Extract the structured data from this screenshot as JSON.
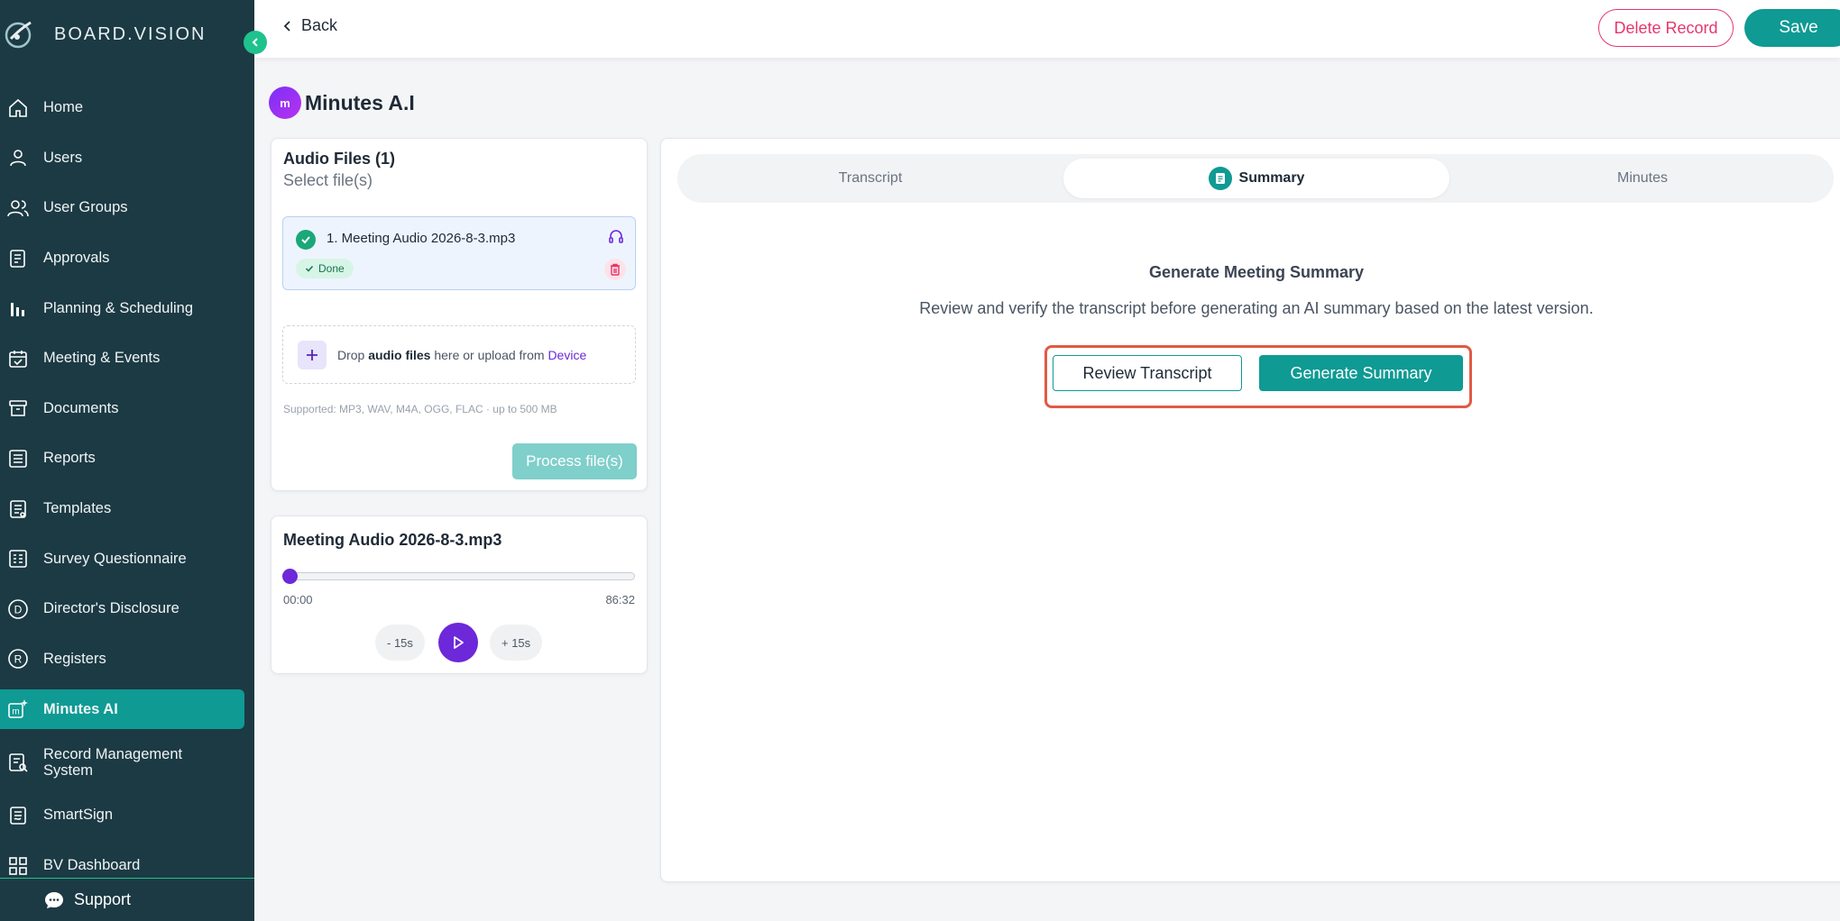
{
  "app": {
    "brand": "BOARD.VISION"
  },
  "sidebar": {
    "items": [
      {
        "label": "Home",
        "icon": "home-icon"
      },
      {
        "label": "Users",
        "icon": "user-icon"
      },
      {
        "label": "User Groups",
        "icon": "users-icon"
      },
      {
        "label": "Approvals",
        "icon": "document-check-icon"
      },
      {
        "label": "Planning & Scheduling",
        "icon": "bar-chart-icon"
      },
      {
        "label": "Meeting & Events",
        "icon": "calendar-icon"
      },
      {
        "label": "Documents",
        "icon": "archive-icon"
      },
      {
        "label": "Reports",
        "icon": "list-icon"
      },
      {
        "label": "Templates",
        "icon": "template-icon"
      },
      {
        "label": "Survey Questionnaire",
        "icon": "survey-icon"
      },
      {
        "label": "Director's Disclosure",
        "icon": "d-circle-icon"
      },
      {
        "label": "Registers",
        "icon": "r-circle-icon"
      },
      {
        "label": "Minutes AI",
        "icon": "minutes-ai-icon",
        "active": true
      },
      {
        "label": "Record Management System",
        "icon": "record-search-icon"
      },
      {
        "label": "SmartSign",
        "icon": "smartsign-icon"
      },
      {
        "label": "BV Dashboard",
        "icon": "grid-icon"
      }
    ],
    "support_label": "Support"
  },
  "topbar": {
    "back_label": "Back",
    "delete_label": "Delete Record",
    "save_label": "Save"
  },
  "page": {
    "title": "Minutes A.I",
    "badge": "m"
  },
  "files": {
    "title": "Audio Files (1)",
    "subtitle": "Select file(s)",
    "items": [
      {
        "name": "1. Meeting Audio 2026-8-3.mp3",
        "status": "Done"
      }
    ],
    "drop_prefix": "Drop ",
    "drop_bold": "audio files",
    "drop_middle": " here or upload from ",
    "drop_link": "Device",
    "supported": "Supported: MP3, WAV, M4A, OGG, FLAC · up to 500 MB",
    "process_label": "Process file(s)"
  },
  "player": {
    "title": "Meeting Audio 2026-8-3.mp3",
    "current": "00:00",
    "duration": "86:32",
    "progress": 0,
    "back_label": "- 15s",
    "fwd_label": "+ 15s"
  },
  "tabs": [
    {
      "label": "Transcript"
    },
    {
      "label": "Summary",
      "active": true
    },
    {
      "label": "Minutes"
    }
  ],
  "summary": {
    "heading": "Generate Meeting Summary",
    "description": "Review and verify the transcript before generating an AI summary based on the latest version.",
    "review_label": "Review Transcript",
    "generate_label": "Generate Summary"
  },
  "colors": {
    "sidebar": "#1c3a44",
    "accent": "#0f9a94",
    "danger": "#e8356d",
    "purple": "#6d28d9",
    "highlight": "#e05a44"
  }
}
